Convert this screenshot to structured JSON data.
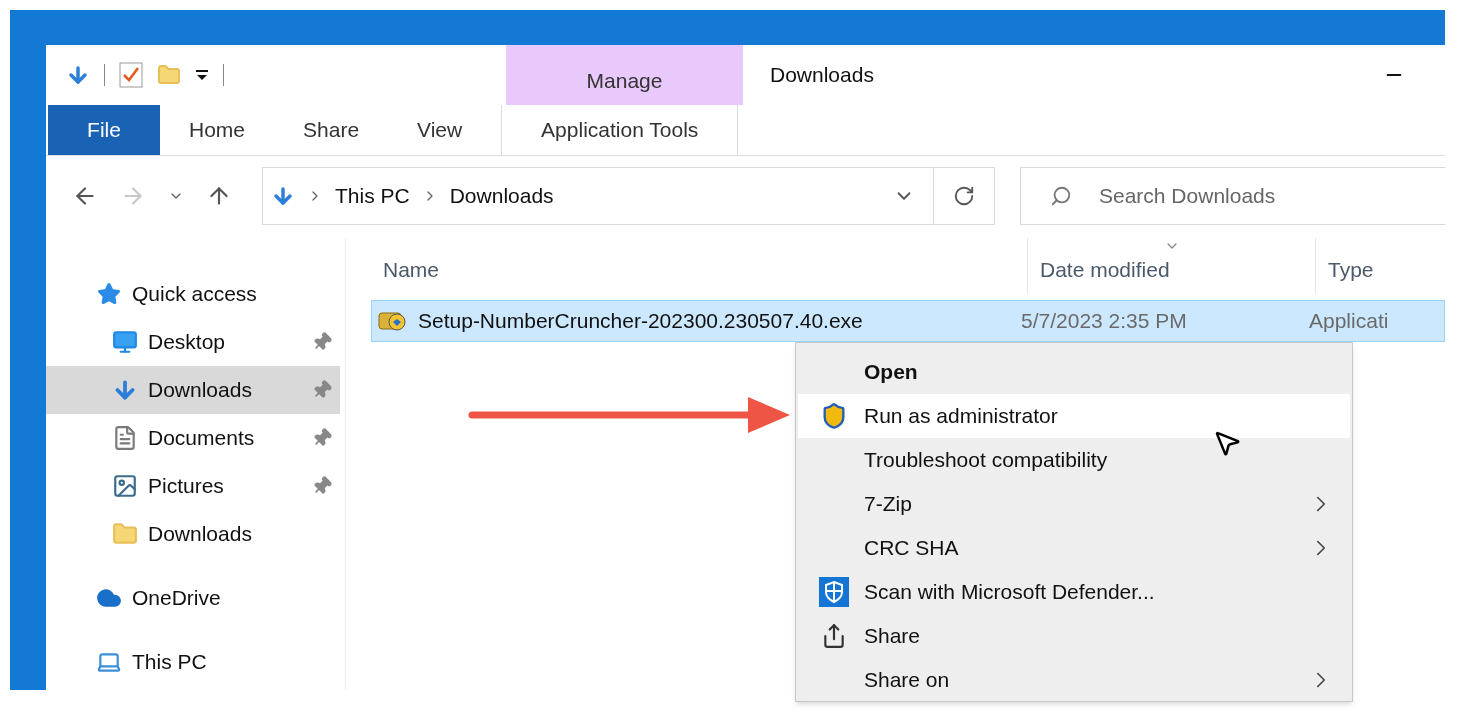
{
  "window": {
    "title": "Downloads",
    "contextual_group": "Manage"
  },
  "ribbon_tabs": [
    {
      "label": "File",
      "kind": "file",
      "selected": false
    },
    {
      "label": "Home",
      "kind": "normal",
      "selected": false
    },
    {
      "label": "Share",
      "kind": "normal",
      "selected": false
    },
    {
      "label": "View",
      "kind": "normal",
      "selected": false
    },
    {
      "label": "Application Tools",
      "kind": "contextual",
      "selected": false
    }
  ],
  "address": {
    "crumbs": [
      "This PC",
      "Downloads"
    ]
  },
  "search": {
    "placeholder": "Search Downloads"
  },
  "sidebar": {
    "items": [
      {
        "label": "Quick access",
        "kind": "star",
        "selected": false,
        "children": [
          {
            "label": "Desktop",
            "kind": "desktop",
            "pinned": true,
            "selected": false
          },
          {
            "label": "Downloads",
            "kind": "download",
            "pinned": true,
            "selected": true
          },
          {
            "label": "Documents",
            "kind": "document",
            "pinned": true,
            "selected": false
          },
          {
            "label": "Pictures",
            "kind": "picture",
            "pinned": true,
            "selected": false
          },
          {
            "label": "Downloads",
            "kind": "folder",
            "pinned": false,
            "selected": false
          }
        ]
      },
      {
        "label": "OneDrive",
        "kind": "cloud",
        "selected": false
      },
      {
        "label": "This PC",
        "kind": "pc",
        "selected": false
      }
    ]
  },
  "table": {
    "columns": [
      {
        "label": "Name",
        "sorted": false
      },
      {
        "label": "Date modified",
        "sorted": true
      },
      {
        "label": "Type",
        "sorted": false
      }
    ],
    "rows": [
      {
        "name": "Setup-NumberCruncher-202300.230507.40.exe",
        "date": "5/7/2023 2:35 PM",
        "type": "Applicati",
        "selected": true
      }
    ]
  },
  "context_menu": {
    "items": [
      {
        "label": "Open",
        "kind": "default",
        "submenu": false,
        "selected": false
      },
      {
        "label": "Run as administrator",
        "kind": "shield",
        "submenu": false,
        "selected": true
      },
      {
        "label": "Troubleshoot compatibility",
        "kind": "plain",
        "submenu": false,
        "selected": false
      },
      {
        "label": "7-Zip",
        "kind": "plain",
        "submenu": true,
        "selected": false
      },
      {
        "label": "CRC SHA",
        "kind": "plain",
        "submenu": true,
        "selected": false
      },
      {
        "label": "Scan with Microsoft Defender...",
        "kind": "defender",
        "submenu": false,
        "selected": false
      },
      {
        "label": "Share",
        "kind": "share",
        "submenu": false,
        "selected": false
      },
      {
        "label": "Share on",
        "kind": "plain",
        "submenu": true,
        "selected": false
      }
    ]
  }
}
